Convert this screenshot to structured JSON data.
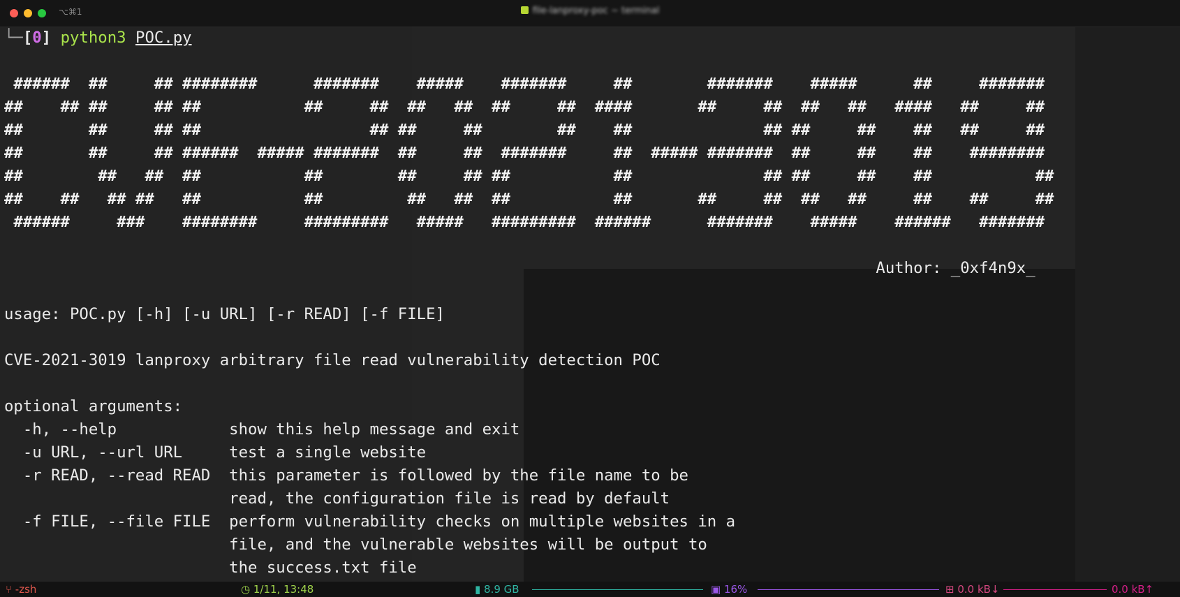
{
  "window": {
    "shortcut": "⌥⌘1",
    "title_blurred": "file-lanproxy-poc ~ terminal"
  },
  "prompt": {
    "corner": "└─",
    "bracket_open": "[",
    "exit_code": "0",
    "bracket_close": "]",
    "command": "python3",
    "argument": "POC.py"
  },
  "banner": [
    " ######  ##     ## ########      #######    #####    #######     ##        #######    #####      ##     #######",
    "##    ## ##     ## ##           ##     ##  ##   ##  ##     ##  ####       ##     ##  ##   ##   ####   ##     ##",
    "##       ##     ## ##                  ## ##     ##        ##    ##              ## ##     ##    ##   ##     ##",
    "##       ##     ## ######  ##### #######  ##     ##  #######     ##  ##### #######  ##     ##    ##    ########",
    "##        ##   ##  ##           ##        ##     ## ##           ##              ## ##     ##    ##           ##",
    "##    ##   ## ##   ##           ##         ##   ##  ##           ##       ##     ##  ##   ##     ##    ##     ##",
    " ######     ###    ########     #########   #####   #########  ######      #######    #####    ######   #######"
  ],
  "author_line": "                                                                                             Author: _0xf4n9x_",
  "help": {
    "usage": "usage: POC.py [-h] [-u URL] [-r READ] [-f FILE]",
    "description": "CVE-2021-3019 lanproxy arbitrary file read vulnerability detection POC",
    "optional_header": "optional arguments:",
    "args": [
      "  -h, --help            show this help message and exit",
      "  -u URL, --url URL     test a single website",
      "  -r READ, --read READ  this parameter is followed by the file name to be",
      "                        read, the configuration file is read by default",
      "  -f FILE, --file FILE  perform vulnerability checks on multiple websites in a",
      "                        file, and the vulnerable websites will be output to",
      "                        the success.txt file"
    ]
  },
  "statusbar": {
    "shell": "-zsh",
    "datetime": "1/11, 13:48",
    "memory": "8.9 GB",
    "cpu": "16%",
    "net_down": "0.0 kB↓",
    "net_up": "0.0 kB↑",
    "colors": {
      "shell": "#e0574d",
      "time": "#9fd24a",
      "memory": "#2fb5a3",
      "cpu": "#9b57e8",
      "net_down": "#d4477f",
      "net_up": "#d61f88"
    }
  }
}
